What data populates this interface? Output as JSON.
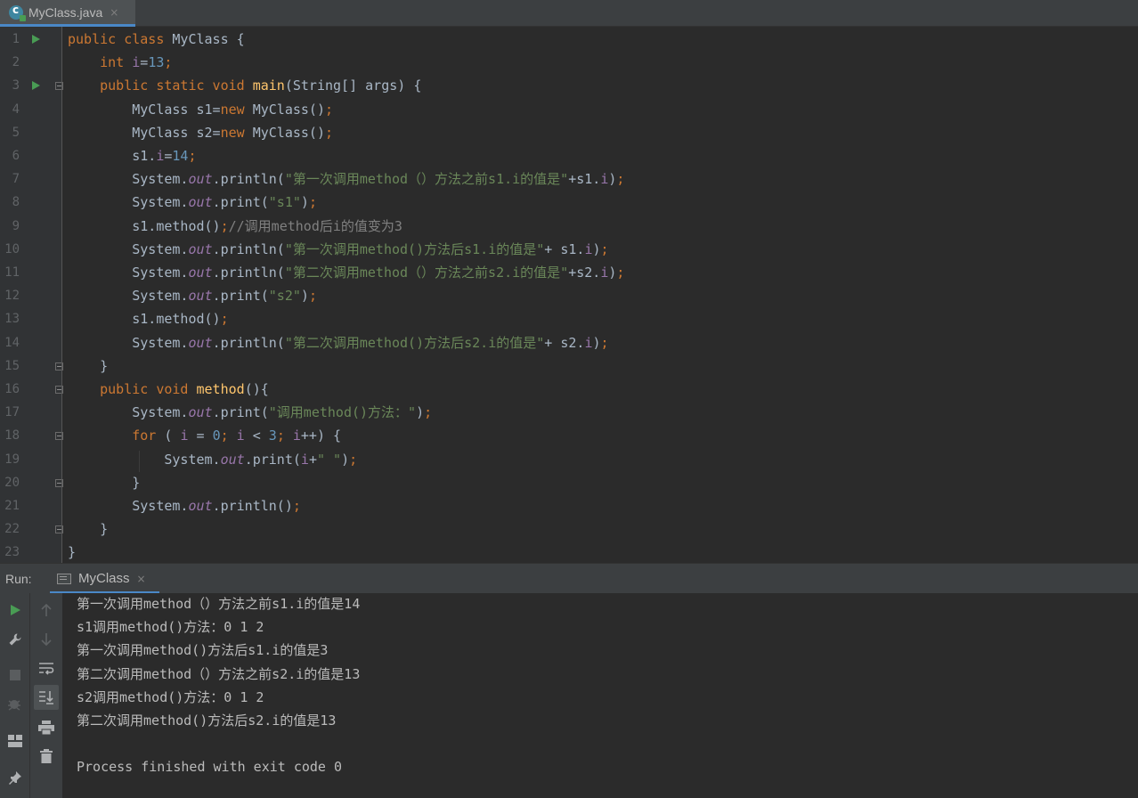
{
  "editor_tab": {
    "title": "MyClass.java",
    "close": "×"
  },
  "code_lines": [
    {
      "n": "1",
      "segs": [
        {
          "c": "kw",
          "t": "public class "
        },
        {
          "c": "",
          "t": "MyClass {"
        }
      ]
    },
    {
      "n": "2",
      "segs": [
        {
          "c": "",
          "t": "    "
        },
        {
          "c": "kw",
          "t": "int "
        },
        {
          "c": "fld",
          "t": "i"
        },
        {
          "c": "",
          "t": "="
        },
        {
          "c": "num",
          "t": "13"
        },
        {
          "c": "kw",
          "t": ";"
        }
      ]
    },
    {
      "n": "3",
      "segs": [
        {
          "c": "",
          "t": "    "
        },
        {
          "c": "kw",
          "t": "public static void "
        },
        {
          "c": "fn",
          "t": "main"
        },
        {
          "c": "",
          "t": "(String[] args) {"
        }
      ]
    },
    {
      "n": "4",
      "segs": [
        {
          "c": "",
          "t": "        MyClass s1="
        },
        {
          "c": "kw",
          "t": "new "
        },
        {
          "c": "",
          "t": "MyClass()"
        },
        {
          "c": "kw",
          "t": ";"
        }
      ]
    },
    {
      "n": "5",
      "segs": [
        {
          "c": "",
          "t": "        MyClass s2="
        },
        {
          "c": "kw",
          "t": "new "
        },
        {
          "c": "",
          "t": "MyClass()"
        },
        {
          "c": "kw",
          "t": ";"
        }
      ]
    },
    {
      "n": "6",
      "segs": [
        {
          "c": "",
          "t": "        s1."
        },
        {
          "c": "fld",
          "t": "i"
        },
        {
          "c": "",
          "t": "="
        },
        {
          "c": "num",
          "t": "14"
        },
        {
          "c": "kw",
          "t": ";"
        }
      ]
    },
    {
      "n": "7",
      "segs": [
        {
          "c": "",
          "t": "        System."
        },
        {
          "c": "st",
          "t": "out"
        },
        {
          "c": "",
          "t": ".println("
        },
        {
          "c": "str",
          "t": "\"第一次调用method（）方法之前s1.i的值是\""
        },
        {
          "c": "",
          "t": "+s1."
        },
        {
          "c": "fld",
          "t": "i"
        },
        {
          "c": "",
          "t": ")"
        },
        {
          "c": "kw",
          "t": ";"
        }
      ]
    },
    {
      "n": "8",
      "segs": [
        {
          "c": "",
          "t": "        System."
        },
        {
          "c": "st",
          "t": "out"
        },
        {
          "c": "",
          "t": ".print("
        },
        {
          "c": "str",
          "t": "\"s1\""
        },
        {
          "c": "",
          "t": ")"
        },
        {
          "c": "kw",
          "t": ";"
        }
      ]
    },
    {
      "n": "9",
      "segs": [
        {
          "c": "",
          "t": "        s1.method()"
        },
        {
          "c": "kw",
          "t": ";"
        },
        {
          "c": "cmt",
          "t": "//调用method后i的值变为3"
        }
      ]
    },
    {
      "n": "10",
      "segs": [
        {
          "c": "",
          "t": "        System."
        },
        {
          "c": "st",
          "t": "out"
        },
        {
          "c": "",
          "t": ".println("
        },
        {
          "c": "str",
          "t": "\"第一次调用method()方法后s1.i的值是\""
        },
        {
          "c": "",
          "t": "+ s1."
        },
        {
          "c": "fld",
          "t": "i"
        },
        {
          "c": "",
          "t": ")"
        },
        {
          "c": "kw",
          "t": ";"
        }
      ]
    },
    {
      "n": "11",
      "segs": [
        {
          "c": "",
          "t": "        System."
        },
        {
          "c": "st",
          "t": "out"
        },
        {
          "c": "",
          "t": ".println("
        },
        {
          "c": "str",
          "t": "\"第二次调用method（）方法之前s2.i的值是\""
        },
        {
          "c": "",
          "t": "+s2."
        },
        {
          "c": "fld",
          "t": "i"
        },
        {
          "c": "",
          "t": ")"
        },
        {
          "c": "kw",
          "t": ";"
        }
      ]
    },
    {
      "n": "12",
      "segs": [
        {
          "c": "",
          "t": "        System."
        },
        {
          "c": "st",
          "t": "out"
        },
        {
          "c": "",
          "t": ".print("
        },
        {
          "c": "str",
          "t": "\"s2\""
        },
        {
          "c": "",
          "t": ")"
        },
        {
          "c": "kw",
          "t": ";"
        }
      ]
    },
    {
      "n": "13",
      "segs": [
        {
          "c": "",
          "t": "        s1.method()"
        },
        {
          "c": "kw",
          "t": ";"
        }
      ]
    },
    {
      "n": "14",
      "segs": [
        {
          "c": "",
          "t": "        System."
        },
        {
          "c": "st",
          "t": "out"
        },
        {
          "c": "",
          "t": ".println("
        },
        {
          "c": "str",
          "t": "\"第二次调用method()方法后s2.i的值是\""
        },
        {
          "c": "",
          "t": "+ s2."
        },
        {
          "c": "fld",
          "t": "i"
        },
        {
          "c": "",
          "t": ")"
        },
        {
          "c": "kw",
          "t": ";"
        }
      ]
    },
    {
      "n": "15",
      "segs": [
        {
          "c": "",
          "t": "    }"
        }
      ]
    },
    {
      "n": "16",
      "segs": [
        {
          "c": "",
          "t": "    "
        },
        {
          "c": "kw",
          "t": "public void "
        },
        {
          "c": "fn",
          "t": "method"
        },
        {
          "c": "",
          "t": "(){"
        }
      ]
    },
    {
      "n": "17",
      "segs": [
        {
          "c": "",
          "t": "        System."
        },
        {
          "c": "st",
          "t": "out"
        },
        {
          "c": "",
          "t": ".print("
        },
        {
          "c": "str",
          "t": "\"调用method()方法：\""
        },
        {
          "c": "",
          "t": ")"
        },
        {
          "c": "kw",
          "t": ";"
        }
      ]
    },
    {
      "n": "18",
      "segs": [
        {
          "c": "",
          "t": "        "
        },
        {
          "c": "kw",
          "t": "for "
        },
        {
          "c": "",
          "t": "( "
        },
        {
          "c": "fld",
          "t": "i"
        },
        {
          "c": "",
          "t": " = "
        },
        {
          "c": "num",
          "t": "0"
        },
        {
          "c": "kw",
          "t": "; "
        },
        {
          "c": "fld",
          "t": "i"
        },
        {
          "c": "",
          "t": " < "
        },
        {
          "c": "num",
          "t": "3"
        },
        {
          "c": "kw",
          "t": "; "
        },
        {
          "c": "fld",
          "t": "i"
        },
        {
          "c": "",
          "t": "++) {"
        }
      ]
    },
    {
      "n": "19",
      "segs": [
        {
          "c": "",
          "t": "            System."
        },
        {
          "c": "st",
          "t": "out"
        },
        {
          "c": "",
          "t": ".print("
        },
        {
          "c": "fld",
          "t": "i"
        },
        {
          "c": "",
          "t": "+"
        },
        {
          "c": "str",
          "t": "\" \""
        },
        {
          "c": "",
          "t": ")"
        },
        {
          "c": "kw",
          "t": ";"
        }
      ]
    },
    {
      "n": "20",
      "segs": [
        {
          "c": "",
          "t": "        }"
        }
      ]
    },
    {
      "n": "21",
      "segs": [
        {
          "c": "",
          "t": "        System."
        },
        {
          "c": "st",
          "t": "out"
        },
        {
          "c": "",
          "t": ".println()"
        },
        {
          "c": "kw",
          "t": ";"
        }
      ]
    },
    {
      "n": "22",
      "segs": [
        {
          "c": "",
          "t": "    }"
        }
      ]
    },
    {
      "n": "23",
      "segs": [
        {
          "c": "",
          "t": "}"
        }
      ]
    }
  ],
  "run_panel": {
    "label": "Run:",
    "tab_title": "MyClass",
    "close": "×",
    "output": [
      "第一次调用method（）方法之前s1.i的值是14",
      "s1调用method()方法：0 1 2",
      "第一次调用method()方法后s1.i的值是3",
      "第二次调用method（）方法之前s2.i的值是13",
      "s2调用method()方法：0 1 2",
      "第二次调用method()方法后s2.i的值是13",
      "",
      "Process finished with exit code 0"
    ]
  },
  "icons": {
    "left_tools": [
      "rerun-icon",
      "wrench-icon",
      "stop-icon",
      "debug-icon",
      "layout-icon",
      "pin-icon"
    ],
    "mid_tools": [
      "arrow-up-icon",
      "arrow-down-icon",
      "soft-wrap-icon",
      "scroll-to-end-icon",
      "print-icon",
      "trash-icon"
    ]
  },
  "colors": {
    "keyword": "#cc7832",
    "number": "#6897bb",
    "field": "#9876aa",
    "string": "#6a8759",
    "method": "#ffc66d",
    "comment": "#808080",
    "run_green": "#499c54"
  }
}
